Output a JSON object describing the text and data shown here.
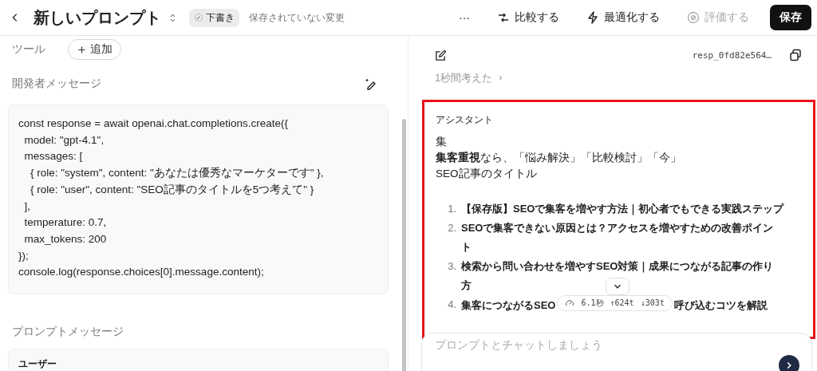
{
  "header": {
    "title": "新しいプロンプト",
    "badge": "下書き",
    "status": "保存されていない変更",
    "actions": [
      {
        "label": "···",
        "kind": "more",
        "disabled": false
      },
      {
        "label": "比較する",
        "kind": "compare",
        "disabled": false
      },
      {
        "label": "最適化する",
        "kind": "optimize",
        "disabled": false
      },
      {
        "label": "評価する",
        "kind": "evaluate",
        "disabled": true
      }
    ],
    "save": "保存"
  },
  "left": {
    "tools_label": "ツール",
    "add_button": "追加",
    "developer_label": "開発者メッセージ",
    "code_lines": [
      "const response = await openai.chat.completions.create({",
      "  model: \"gpt-4.1\",",
      "  messages: [",
      "    { role: \"system\", content: \"あなたは優秀なマーケターです\" },",
      "    { role: \"user\", content: \"SEO記事のタイトルを5つ考えて\" }",
      "  ],",
      "  temperature: 0.7,",
      "  max_tokens: 200",
      "});",
      "console.log(response.choices[0].message.content);"
    ],
    "prompt_label": "プロンプトメッセージ",
    "user_label": "ユーザー"
  },
  "right": {
    "response_id": "resp_0fd82e564…",
    "thought": "1秒間考えた",
    "thought_arrow": "›",
    "assistant": {
      "highlighted": true,
      "role": "アシスタント",
      "lines": [
        "集",
        "**集客重視**なら、「悩み解決」「比較検討」「今」",
        "SEO記事のタイトル"
      ],
      "items": [
        {
          "number": "1.",
          "text": "【保存版】SEOで集客を増やす方法｜初心者でもできる実践ステップ"
        },
        {
          "number": "2.",
          "lines": [
            "SEOで集客できない原因とは？アクセスを増やすための改善ポイン",
            "ト"
          ]
        },
        {
          "number": "3.",
          "lines": [
            "検索から問い合わせを増やすSEO対策｜成果につながる記事の作り",
            "方"
          ]
        },
        {
          "number": "4.",
          "text": "集客につながるSEO",
          "text_after": "呼び込むコツを解説"
        }
      ]
    },
    "stats": {
      "time": "6.1秒",
      "input": "↑624t",
      "output": "↓303t"
    },
    "input_placeholder": "プロンプトとチャットしましょう"
  }
}
